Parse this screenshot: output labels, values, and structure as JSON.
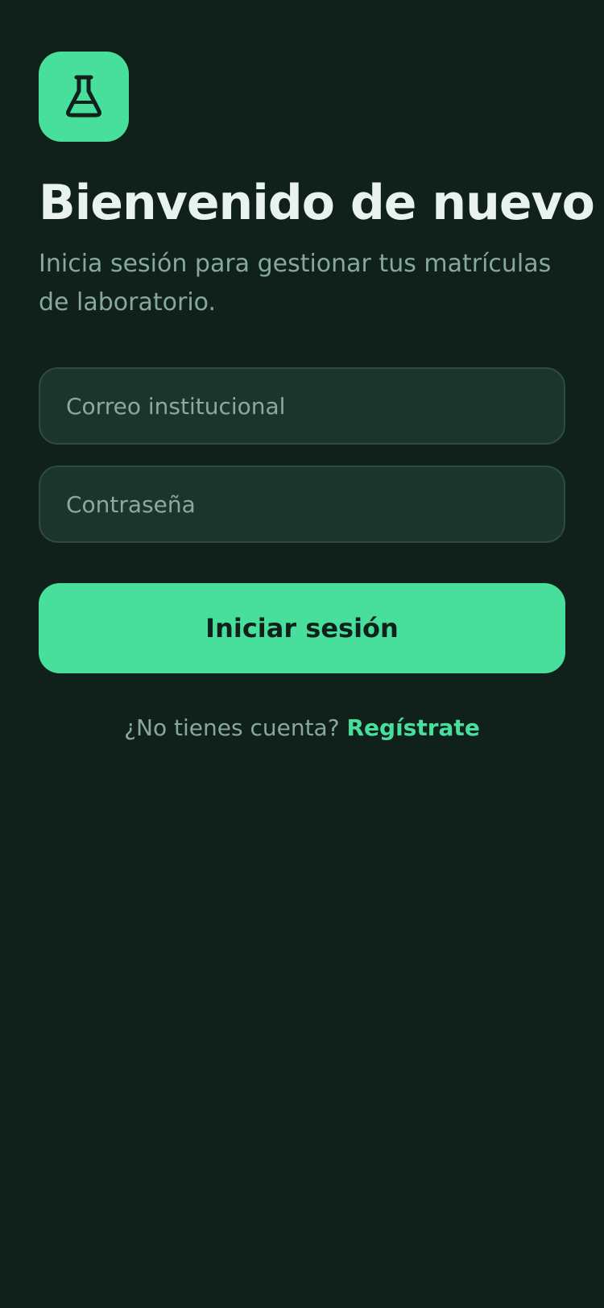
{
  "app": {
    "logo_icon": "flask-icon",
    "accent_color": "#48df9c",
    "background_color": "#10201b"
  },
  "login": {
    "title": "Bienvenido de nuevo",
    "subtitle": "Inicia sesión para gestionar tus matrículas de laboratorio.",
    "email_placeholder": "Correo institucional",
    "email_value": "",
    "password_placeholder": "Contraseña",
    "password_value": "",
    "submit_label": "Iniciar sesión",
    "signup_prompt": "¿No tienes cuenta?",
    "signup_link": "Regístrate"
  }
}
